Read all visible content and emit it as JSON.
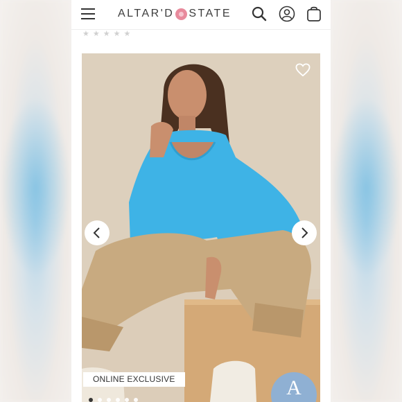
{
  "header": {
    "logo_text_left": "ALTAR'D",
    "logo_text_right": "STATE",
    "icons": [
      "menu-icon",
      "search-icon",
      "account-icon",
      "shopping-bag-icon"
    ]
  },
  "rating": {
    "stars": "★★★★★",
    "value": 0
  },
  "product": {
    "badge": "ONLINE EXCLUSIVE",
    "carousel": {
      "total": 6,
      "current": 1
    },
    "brand_mark": "A"
  },
  "colors": {
    "sweater": "#3eb3e6",
    "pants": "#c8aa80",
    "background": "#d9cbb9",
    "brand_circle": "#8fb0d3"
  }
}
